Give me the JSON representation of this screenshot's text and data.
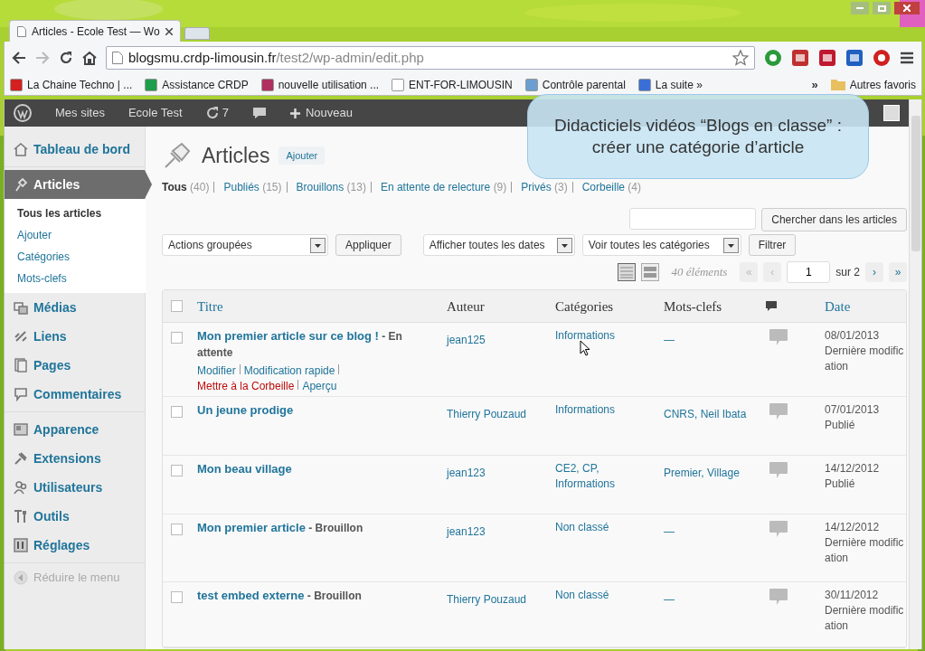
{
  "browser": {
    "tab_title": "Articles - Ecole Test — Wo",
    "url_host": "blogsmu.crdp-limousin.fr",
    "url_path": "/test2/wp-admin/edit.php",
    "bookmarks": [
      {
        "label": "La Chaine Techno | ...",
        "color": "#d42020"
      },
      {
        "label": "Assistance CRDP",
        "color": "#1e9e4a"
      },
      {
        "label": "nouvelle utilisation ...",
        "color": "#b03060"
      },
      {
        "label": "ENT-FOR-LIMOUSIN",
        "color": "#ffffff"
      },
      {
        "label": "Contrôle parental",
        "color": "#6a9fd0"
      },
      {
        "label": "La suite »",
        "color": "#3a6fd8"
      }
    ],
    "bookmarks_more": "»",
    "other_bookmarks": "Autres favoris"
  },
  "admin_bar": [
    {
      "kind": "logo"
    },
    {
      "kind": "text",
      "label": "Mes sites"
    },
    {
      "kind": "text",
      "label": "Ecole Test"
    },
    {
      "kind": "updates",
      "label": "7"
    },
    {
      "kind": "comments"
    },
    {
      "kind": "new",
      "label": "Nouveau"
    }
  ],
  "sidebar": {
    "groups": [
      [
        {
          "label": "Tableau de bord",
          "selected": false
        }
      ],
      [
        {
          "label": "Articles",
          "selected": true,
          "children": [
            {
              "label": "Tous les articles",
              "selected": true
            },
            {
              "label": "Ajouter",
              "selected": false
            },
            {
              "label": "Catégories",
              "selected": false
            },
            {
              "label": "Mots-clefs",
              "selected": false
            }
          ]
        },
        {
          "label": "Médias",
          "selected": false
        },
        {
          "label": "Liens",
          "selected": false
        },
        {
          "label": "Pages",
          "selected": false
        },
        {
          "label": "Commentaires",
          "selected": false
        }
      ],
      [
        {
          "label": "Apparence",
          "selected": false
        },
        {
          "label": "Extensions",
          "selected": false
        },
        {
          "label": "Utilisateurs",
          "selected": false
        },
        {
          "label": "Outils",
          "selected": false
        },
        {
          "label": "Réglages",
          "selected": false
        }
      ]
    ],
    "collapse": "Réduire le menu"
  },
  "page": {
    "title": "Articles",
    "add_button": "Ajouter"
  },
  "status_filters": [
    {
      "label": "Tous",
      "count": "(40)",
      "selected": true
    },
    {
      "label": "Publiés",
      "count": "(15)",
      "selected": false
    },
    {
      "label": "Brouillons",
      "count": "(13)",
      "selected": false
    },
    {
      "label": "En attente de relecture",
      "count": "(9)",
      "selected": false
    },
    {
      "label": "Privés",
      "count": "(3)",
      "selected": false
    },
    {
      "label": "Corbeille",
      "count": "(4)",
      "selected": false
    }
  ],
  "search_button": "Chercher dans les articles",
  "bulk_actions": {
    "value": "Actions groupées",
    "button": "Appliquer"
  },
  "date_filter": "Afficher toutes les dates",
  "category_filter": "Voir toutes les catégories",
  "filter_button": "Filtrer",
  "view_modes": [
    {
      "selected": true
    },
    {
      "selected": false
    }
  ],
  "pagination": {
    "count": "40 éléments",
    "first": "«",
    "prev": "‹",
    "page": "1",
    "total": "sur 2",
    "next": "›",
    "last": "»"
  },
  "table": {
    "select_all_checked": false,
    "columns": [
      {
        "kind": "link",
        "label": "Titre"
      },
      {
        "kind": "plain",
        "label": "Auteur"
      },
      {
        "kind": "plain",
        "label": "Catégories"
      },
      {
        "kind": "plain",
        "label": "Mots-clefs"
      },
      {
        "kind": "comments"
      },
      {
        "kind": "link",
        "label": "Date"
      }
    ],
    "rows": [
      {
        "checked": false,
        "title": "Mon premier article sur ce blog !",
        "state": "- En attente",
        "author": "jean125",
        "categories": "Informations",
        "tags": "—",
        "date": "08/01/2013",
        "date_status": "Dernière modification",
        "actions": [
          {
            "kind": "link",
            "label": "Modifier"
          },
          {
            "kind": "link",
            "label": "Modification rapide"
          },
          {
            "kind": "delete",
            "label": "Mettre à la Corbeille"
          },
          {
            "kind": "link",
            "label": "Aperçu"
          }
        ]
      },
      {
        "checked": false,
        "title": "Un jeune prodige",
        "author": "Thierry Pouzaud",
        "categories": "Informations",
        "tags": "CNRS, Neil Ibata",
        "date": "07/01/2013",
        "date_status": "Publié"
      },
      {
        "checked": false,
        "title": "Mon beau village",
        "author": "jean123",
        "categories": "CE2, CP, Informations",
        "tags": "Premier, Village",
        "date": "14/12/2012",
        "date_status": "Publié"
      },
      {
        "checked": false,
        "title": "Mon premier article",
        "state": "- Brouillon",
        "author": "jean123",
        "categories": "Non classé",
        "tags": "—",
        "date": "14/12/2012",
        "date_status": "Dernière modification"
      },
      {
        "checked": false,
        "title": "test embed externe",
        "state": "- Brouillon",
        "author": "Thierry Pouzaud",
        "categories": "Non classé",
        "tags": "—",
        "date": "30/11/2012",
        "date_status": "Dernière modification"
      }
    ]
  },
  "overlay": {
    "lines": [
      "Didacticiels vidéos “Blogs en classe” :",
      "créer une catégorie d’article"
    ]
  }
}
